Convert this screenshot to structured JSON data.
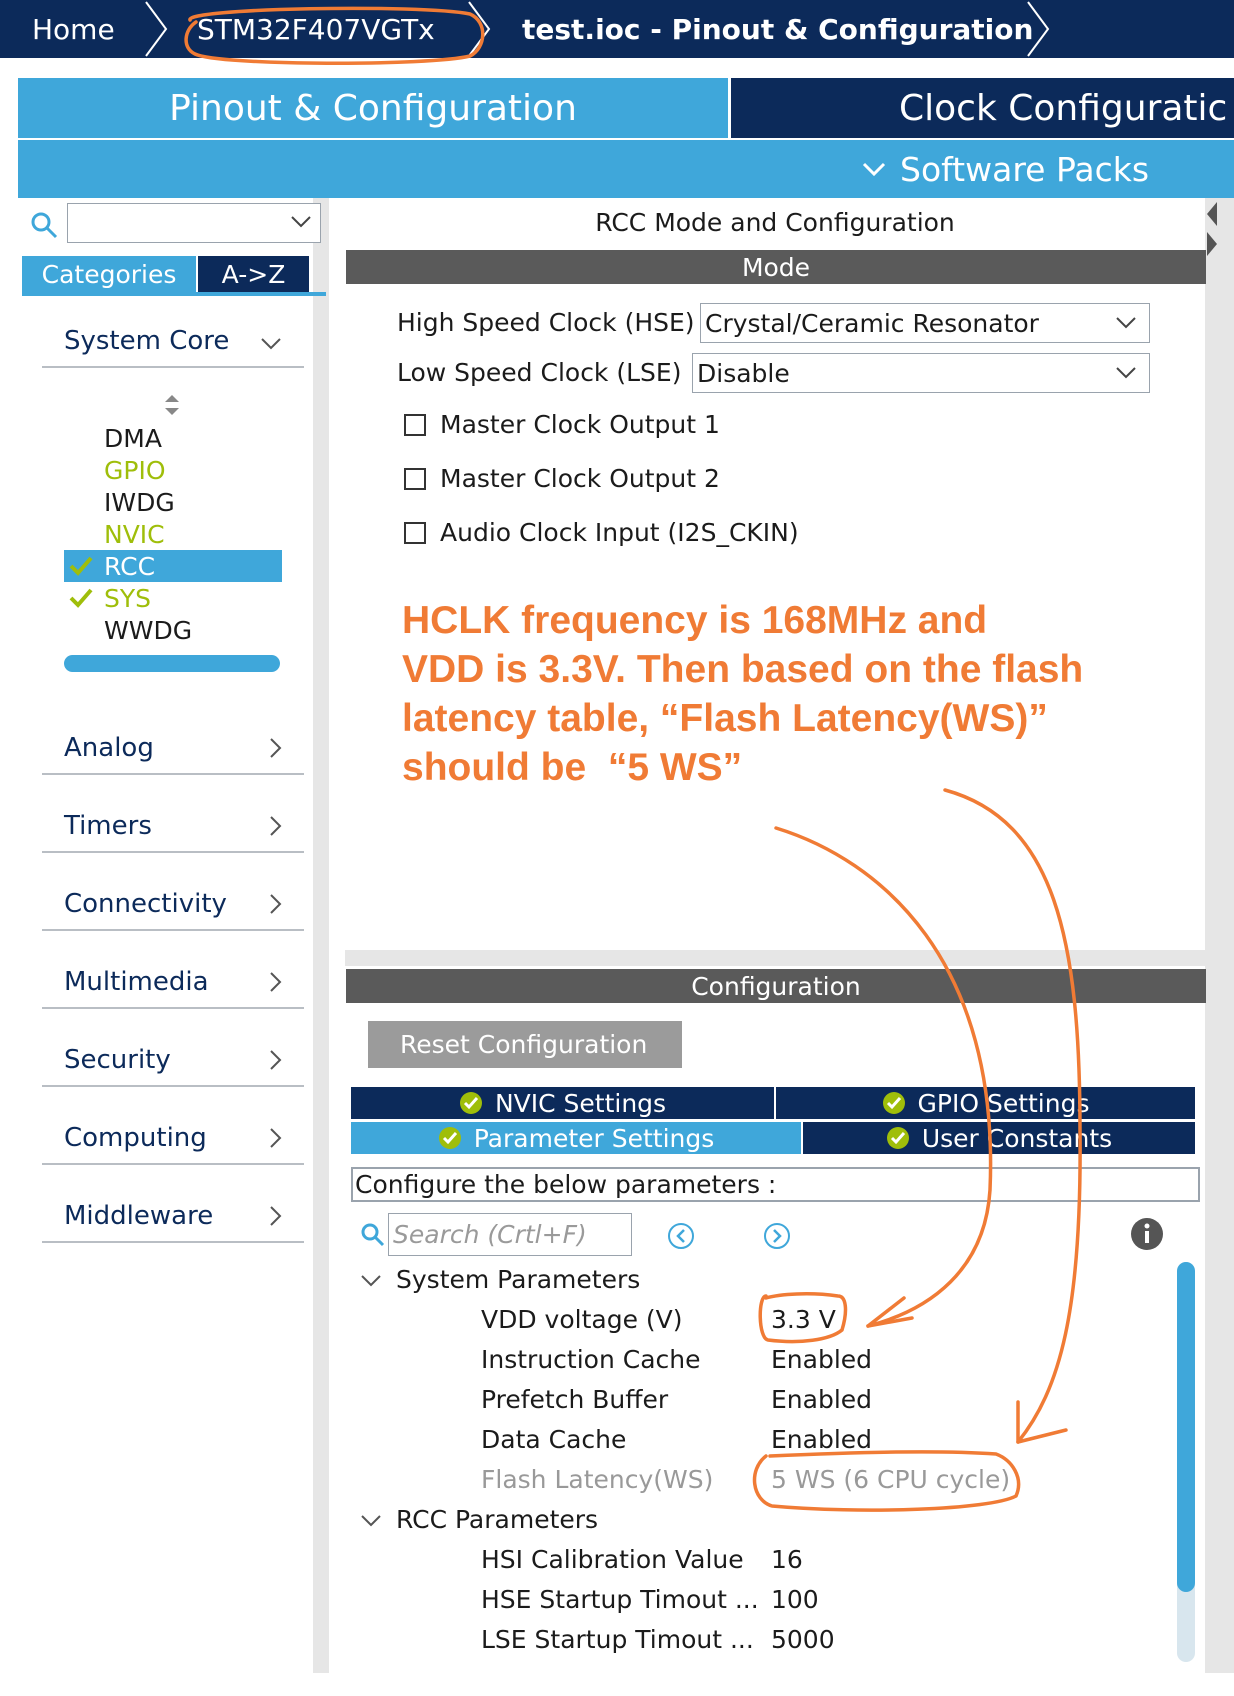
{
  "breadcrumb": {
    "home": "Home",
    "device": "STM32F407VGTx",
    "project": "test.ioc - Pinout & Configuration"
  },
  "main_tabs": {
    "pinout": "Pinout & Configuration",
    "clock": "Clock Configuratic"
  },
  "software_packs": "Software Packs",
  "sidebar": {
    "category_tabs": [
      "Categories",
      "A->Z"
    ],
    "system_core": {
      "label": "System Core",
      "items": [
        {
          "label": "DMA",
          "color": "#1b1b1b",
          "checked": false
        },
        {
          "label": "GPIO",
          "color": "#9fbe0a",
          "checked": false
        },
        {
          "label": "IWDG",
          "color": "#1b1b1b",
          "checked": false
        },
        {
          "label": "NVIC",
          "color": "#9fbe0a",
          "checked": false
        },
        {
          "label": "RCC",
          "color": "#ffffff",
          "checked": true,
          "selected": true
        },
        {
          "label": "SYS",
          "color": "#9fbe0a",
          "checked": true
        },
        {
          "label": "WWDG",
          "color": "#1b1b1b",
          "checked": false
        }
      ]
    },
    "categories": [
      "Analog",
      "Timers",
      "Connectivity",
      "Multimedia",
      "Security",
      "Computing",
      "Middleware"
    ]
  },
  "mode_panel": {
    "title": "RCC Mode and Configuration",
    "mode_header": "Mode",
    "hse_label": "High Speed Clock (HSE)",
    "hse_value": "Crystal/Ceramic Resonator",
    "lse_label": "Low Speed Clock (LSE)",
    "lse_value": "Disable",
    "checkboxes": [
      "Master Clock Output 1",
      "Master Clock Output 2",
      "Audio Clock Input (I2S_CKIN)"
    ]
  },
  "annotation": {
    "lines": [
      "HCLK frequency is 168MHz and",
      "VDD is 3.3V. Then based on the flash",
      "latency table, “Flash Latency(WS)”",
      "should be  “5 WS”"
    ],
    "color": "#f07b35"
  },
  "config_panel": {
    "header": "Configuration",
    "reset_button": "Reset Configuration",
    "tabs": {
      "nvic": "NVIC Settings",
      "gpio": "GPIO Settings",
      "parameter": "Parameter Settings",
      "user_constants": "User Constants"
    },
    "configure_text": "Configure the below parameters :",
    "search_placeholder": "Search (Crtl+F)",
    "system_params": {
      "title": "System Parameters",
      "rows": [
        {
          "label": "VDD voltage (V)",
          "value": "3.3 V"
        },
        {
          "label": "Instruction Cache",
          "value": "Enabled"
        },
        {
          "label": "Prefetch Buffer",
          "value": "Enabled"
        },
        {
          "label": "Data Cache",
          "value": "Enabled"
        },
        {
          "label": "Flash Latency(WS)",
          "value": "5 WS (6 CPU cycle)",
          "disabled": true
        }
      ]
    },
    "rcc_params": {
      "title": "RCC Parameters",
      "rows": [
        {
          "label": "HSI Calibration Value",
          "value": "16"
        },
        {
          "label": "HSE Startup Timout ...",
          "value": "100"
        },
        {
          "label": "LSE Startup Timout ...",
          "value": "5000"
        }
      ]
    }
  },
  "colors": {
    "navy": "#0c2a5a",
    "blue": "#3fa7da",
    "lime": "#9fbe0a",
    "orange_annotation": "#f07b35",
    "bar_gray": "#5a5a5a"
  }
}
